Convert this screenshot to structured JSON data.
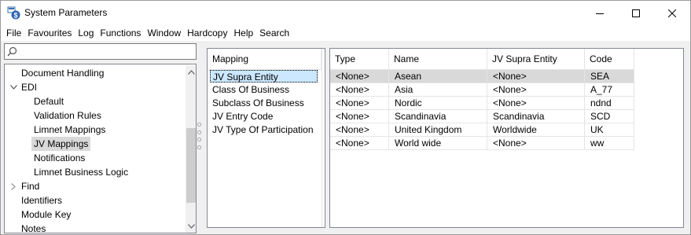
{
  "window": {
    "title": "System Parameters",
    "icon": "system-parameters-icon"
  },
  "menu": [
    "File",
    "Favourites",
    "Log",
    "Functions",
    "Window",
    "Hardcopy",
    "Help",
    "Search"
  ],
  "search": {
    "value": "",
    "placeholder": ""
  },
  "tree": {
    "items": [
      {
        "label": "Document Handling",
        "expander": "",
        "selected": false
      },
      {
        "label": "EDI",
        "expander": "expanded",
        "selected": false
      },
      {
        "label": "Default",
        "expander": "",
        "selected": false
      },
      {
        "label": "Validation Rules",
        "expander": "",
        "selected": false
      },
      {
        "label": "Limnet Mappings",
        "expander": "",
        "selected": false
      },
      {
        "label": "JV Mappings",
        "expander": "",
        "selected": true
      },
      {
        "label": "Notifications",
        "expander": "",
        "selected": false
      },
      {
        "label": "Limnet Business Logic",
        "expander": "",
        "selected": false
      },
      {
        "label": "Find",
        "expander": "collapsed",
        "selected": false
      },
      {
        "label": "Identifiers",
        "expander": "",
        "selected": false
      },
      {
        "label": "Module Key",
        "expander": "",
        "selected": false
      },
      {
        "label": "Notes",
        "expander": "",
        "selected": false
      }
    ]
  },
  "mapping": {
    "header": "Mapping",
    "items": [
      "JV Supra Entity",
      "Class Of Business",
      "Subclass Of Business",
      "JV Entry Code",
      "JV Type Of Participation"
    ],
    "selected_index": 0
  },
  "grid": {
    "columns": [
      "Type",
      "Name",
      "JV Supra Entity",
      "Code"
    ],
    "rows": [
      [
        "<None>",
        "Asean",
        "<None>",
        "SEA"
      ],
      [
        "<None>",
        "Asia",
        "<None>",
        "A_77"
      ],
      [
        "<None>",
        "Nordic",
        "<None>",
        "ndnd"
      ],
      [
        "<None>",
        "Scandinavia",
        "Scandinavia",
        "SCD"
      ],
      [
        "<None>",
        "United Kingdom",
        "Worldwide",
        "UK"
      ],
      [
        "<None>",
        "World wide",
        "<None>",
        "ww"
      ]
    ],
    "selected_index": 0
  }
}
